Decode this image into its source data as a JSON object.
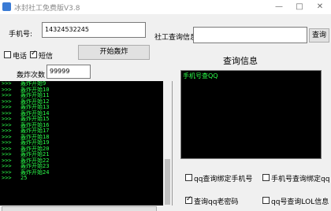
{
  "window": {
    "title": "冰封社工免费版V3.8",
    "min_glyph": "—",
    "max_glyph": "□",
    "close_glyph": "✕"
  },
  "phone": {
    "label": "手机号:",
    "value": "14324532245"
  },
  "social_query": {
    "label": "社工查询信息",
    "value": "",
    "button_label": "查询"
  },
  "options": {
    "phone_label": "电话",
    "phone_checked": false,
    "sms_label": "短信",
    "sms_checked": true
  },
  "start_button_label": "开始轰炸",
  "count": {
    "label": "轰炸次数",
    "value": "99999"
  },
  "console": {
    "prefix": ">>>",
    "lines": [
      "轰炸开始9",
      "轰炸开始10",
      "轰炸开始11",
      "轰炸开始12",
      "轰炸开始13",
      "轰炸开始14",
      "轰炸开始15",
      "轰炸开始16",
      "轰炸开始17",
      "轰炸开始18",
      "轰炸开始19",
      "轰炸开始20",
      "轰炸开始21",
      "轰炸开始22",
      "轰炸开始23",
      "轰炸开始24",
      "25"
    ]
  },
  "results": {
    "heading": "查询信息",
    "text": "手机号查QQ"
  },
  "checkboxes": {
    "qq_bind_phone": {
      "label": "qq查询绑定手机号",
      "checked": false
    },
    "phone_bind_qq": {
      "label": "手机号查询绑定qq",
      "checked": false
    },
    "qq_old_password": {
      "label": "查询qq老密码",
      "checked": true
    },
    "qq_lol_info": {
      "label": "qq号查询LOL信息",
      "checked": false
    }
  },
  "colors": {
    "console_bg": "#000000",
    "console_text": "#2bff4a",
    "window_bg": "#f0f0f0"
  }
}
